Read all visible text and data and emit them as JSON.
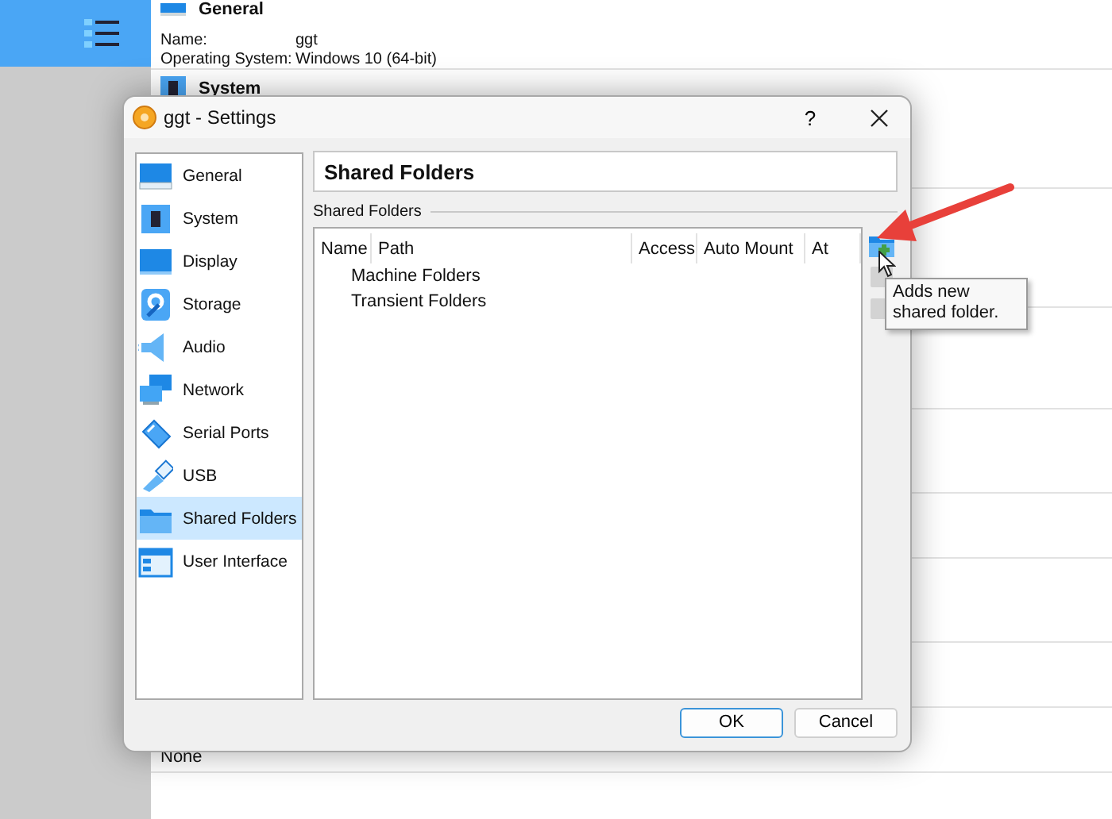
{
  "main_window": {
    "machine_tools": {
      "selected": true
    },
    "details": {
      "general": {
        "title": "General",
        "rows": [
          {
            "label": "Name:",
            "value": "ggt"
          },
          {
            "label": "Operating System:",
            "value": "Windows 10 (64-bit)"
          }
        ]
      },
      "system": {
        "title": "System"
      },
      "bottom_value": "None"
    }
  },
  "dialog": {
    "title": "ggt - Settings",
    "help": "?",
    "categories": [
      {
        "label": "General",
        "selected": false
      },
      {
        "label": "System",
        "selected": false
      },
      {
        "label": "Display",
        "selected": false
      },
      {
        "label": "Storage",
        "selected": false
      },
      {
        "label": "Audio",
        "selected": false
      },
      {
        "label": "Network",
        "selected": false
      },
      {
        "label": "Serial Ports",
        "selected": false
      },
      {
        "label": "USB",
        "selected": false
      },
      {
        "label": "Shared Folders",
        "selected": true
      },
      {
        "label": "User Interface",
        "selected": false
      }
    ],
    "page_title": "Shared Folders",
    "group_label": "Shared Folders",
    "table": {
      "columns": [
        "Name",
        "Path",
        "Access",
        "Auto Mount",
        "At"
      ],
      "rows": [
        {
          "label": "Machine Folders"
        },
        {
          "label": "Transient Folders"
        }
      ]
    },
    "tools": [
      {
        "kind": "add",
        "disabled": false
      },
      {
        "kind": "edit",
        "disabled": true
      },
      {
        "kind": "remove",
        "disabled": true
      }
    ],
    "tooltip": "Adds new shared folder.",
    "buttons": [
      {
        "label": "OK",
        "default": true
      },
      {
        "label": "Cancel",
        "default": false
      }
    ]
  }
}
